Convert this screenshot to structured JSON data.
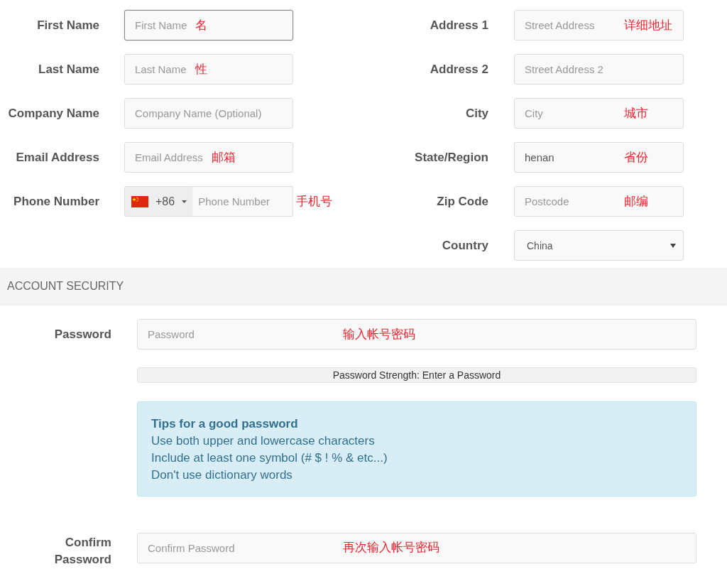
{
  "contact_fields": [
    {
      "kind": "text",
      "label": "First Name",
      "placeholder": "First Name",
      "note": "名",
      "focused": true
    },
    {
      "kind": "text",
      "label": "Last Name",
      "placeholder": "Last Name",
      "note": "性",
      "focused": false
    },
    {
      "kind": "text",
      "label": "Company Name",
      "placeholder": "Company Name (Optional)",
      "focused": false
    },
    {
      "kind": "text",
      "label": "Email Address",
      "placeholder": "Email Address",
      "note": "邮箱",
      "focused": false
    },
    {
      "kind": "phone",
      "label": "Phone Number",
      "dial_code": "+86",
      "placeholder": "Phone Number",
      "note": "手机号",
      "focused": false
    }
  ],
  "address_fields": [
    {
      "kind": "text",
      "label": "Address 1",
      "placeholder": "Street Address",
      "note": "详细地址",
      "focused": false
    },
    {
      "kind": "text",
      "label": "Address 2",
      "placeholder": "Street Address 2",
      "focused": false
    },
    {
      "kind": "text",
      "label": "City",
      "placeholder": "City",
      "note": "城市",
      "focused": false
    },
    {
      "kind": "text",
      "label": "State/Region",
      "value": "henan",
      "note": "省份",
      "focused": false
    },
    {
      "kind": "text",
      "label": "Zip Code",
      "placeholder": "Postcode",
      "note": "邮编",
      "focused": false
    },
    {
      "kind": "select",
      "label": "Country",
      "value": "China",
      "focused": false
    }
  ],
  "section_header": "ACCOUNT SECURITY",
  "password": {
    "kind": "text",
    "label": "Password",
    "placeholder": "Password",
    "note": "输入帐号密码",
    "focused": false
  },
  "strength": {
    "text": "Password Strength: Enter a Password"
  },
  "tips": {
    "title": "Tips for a good password",
    "lines": [
      "Use both upper and lowercase characters",
      "Include at least one symbol (# $ ! % & etc...)",
      "Don't use dictionary words"
    ]
  },
  "confirm": {
    "kind": "text",
    "label": "Confirm Password",
    "placeholder": "Confirm Password",
    "note": "再次输入帐号密码",
    "focused": false
  }
}
